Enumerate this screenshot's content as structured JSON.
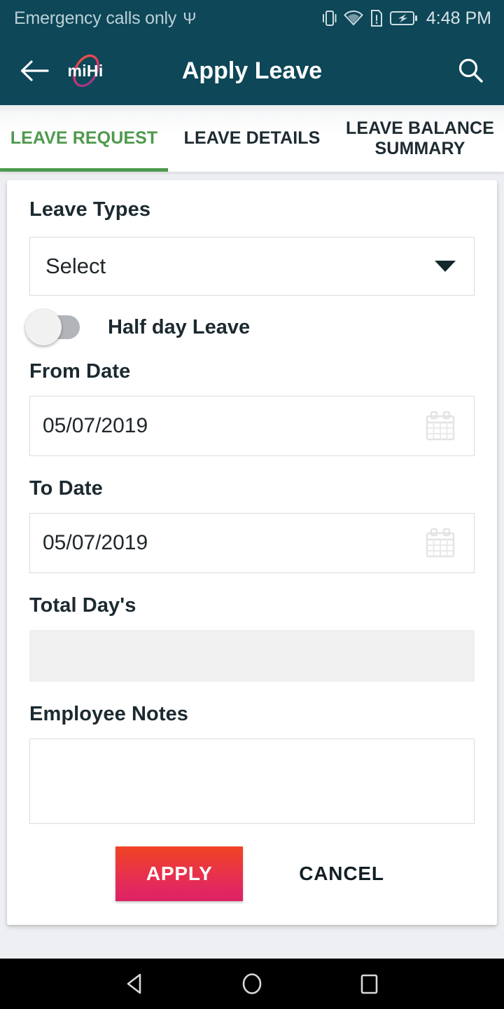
{
  "status_bar": {
    "carrier": "Emergency calls only",
    "usb_icon": "usb-icon",
    "vibrate_icon": "vibrate-icon",
    "wifi_icon": "wifi-icon",
    "sim_alert_icon": "sim-alert-icon",
    "battery_charging_icon": "battery-charging-icon",
    "clock": "4:48 PM"
  },
  "app_bar": {
    "back_icon": "back-arrow-icon",
    "brand": "miHi",
    "brand_ring_icon": "brand-ring-icon",
    "title": "Apply Leave",
    "search_icon": "search-icon",
    "background_color": "#0d4758"
  },
  "tabs": [
    {
      "label": "LEAVE REQUEST",
      "active": true
    },
    {
      "label": "LEAVE DETAILS",
      "active": false
    },
    {
      "label": "LEAVE BALANCE SUMMARY",
      "active": false
    }
  ],
  "tab_accent_color": "#4e9a4e",
  "form": {
    "leave_types": {
      "label": "Leave Types",
      "selected": "Select",
      "caret_icon": "chevron-down-icon"
    },
    "half_day": {
      "label": "Half day Leave",
      "state": "off"
    },
    "from_date": {
      "label": "From Date",
      "value": "05/07/2019",
      "calendar_icon": "calendar-icon"
    },
    "to_date": {
      "label": "To Date",
      "value": "05/07/2019",
      "calendar_icon": "calendar-icon"
    },
    "total_days": {
      "label": "Total Day's",
      "value": ""
    },
    "employee_notes": {
      "label": "Employee Notes",
      "value": "",
      "placeholder": ""
    },
    "apply_label": "APPLY",
    "cancel_label": "CANCEL",
    "apply_color_start": "#ef4423",
    "apply_color_end": "#dc2264"
  },
  "nav_bar": {
    "back_icon": "nav-back-triangle-icon",
    "home_icon": "nav-home-circle-icon",
    "recents_icon": "nav-recents-square-icon"
  }
}
